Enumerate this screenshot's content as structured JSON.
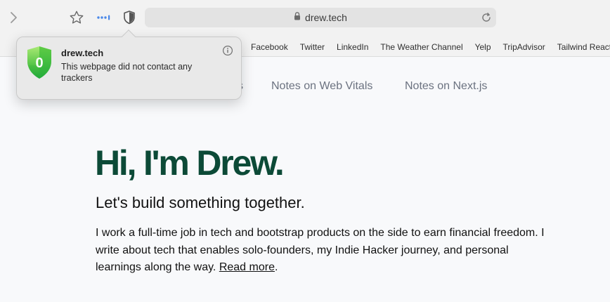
{
  "browser": {
    "url": "drew.tech",
    "icons": {
      "forward": "chevron-right-icon",
      "bookmark": "star-icon",
      "extension": "dotted-extension-icon",
      "privacy": "shield-icon",
      "lock": "lock-icon",
      "reload": "reload-icon"
    }
  },
  "favorites": [
    "Facebook",
    "Twitter",
    "LinkedIn",
    "The Weather Channel",
    "Yelp",
    "TripAdvisor",
    "Tailwind React"
  ],
  "privacy_popover": {
    "domain": "drew.tech",
    "message": "This webpage did not contact any trackers",
    "badge_count": "0",
    "info_icon": "info-icon"
  },
  "page": {
    "nav": {
      "partial": "s",
      "web_vitals": "Notes on Web Vitals",
      "nextjs": "Notes on Next.js"
    },
    "hero_title": "Hi, I'm Drew.",
    "hero_subtitle": "Let's build something together.",
    "intro_text": "I work a full-time job in tech and bootstrap products on the side to earn financial freedom. I write about tech that enables solo-founders, my Indie Hacker journey, and personal learnings along the way. ",
    "read_more": "Read more",
    "intro_end": "."
  },
  "colors": {
    "title_green": "#0c4a37",
    "shield_green_top": "#8be04e",
    "shield_green_bottom": "#1fa83a",
    "nav_gray": "#6b7280"
  }
}
